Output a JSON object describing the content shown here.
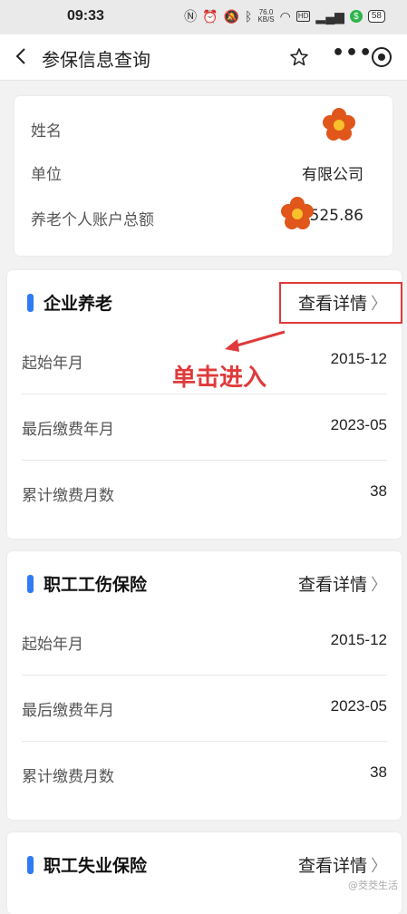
{
  "status_bar": {
    "time": "09:33",
    "net_speed": "76.0",
    "net_unit": "KB/S",
    "hd": "HD",
    "battery": "58"
  },
  "nav": {
    "title": "参保信息查询"
  },
  "info": {
    "name_label": "姓名",
    "unit_label": "单位",
    "unit_value": "有限公司",
    "pension_label": "养老个人账户总额",
    "pension_value": "525.86"
  },
  "cards": [
    {
      "title": "企业养老",
      "detail": "查看详情",
      "rows": [
        {
          "label": "起始年月",
          "value": "2015-12"
        },
        {
          "label": "最后缴费年月",
          "value": "2023-05"
        },
        {
          "label": "累计缴费月数",
          "value": "38"
        }
      ]
    },
    {
      "title": "职工工伤保险",
      "detail": "查看详情",
      "rows": [
        {
          "label": "起始年月",
          "value": "2015-12"
        },
        {
          "label": "最后缴费年月",
          "value": "2023-05"
        },
        {
          "label": "累计缴费月数",
          "value": "38"
        }
      ]
    },
    {
      "title": "职工失业保险",
      "detail": "查看详情"
    }
  ],
  "annotation": {
    "text": "单击进入",
    "color": "#e03a3a"
  },
  "watermark": "@茭茭生活",
  "colors": {
    "accent": "#2f7af5",
    "annotation": "#e03a3a"
  }
}
